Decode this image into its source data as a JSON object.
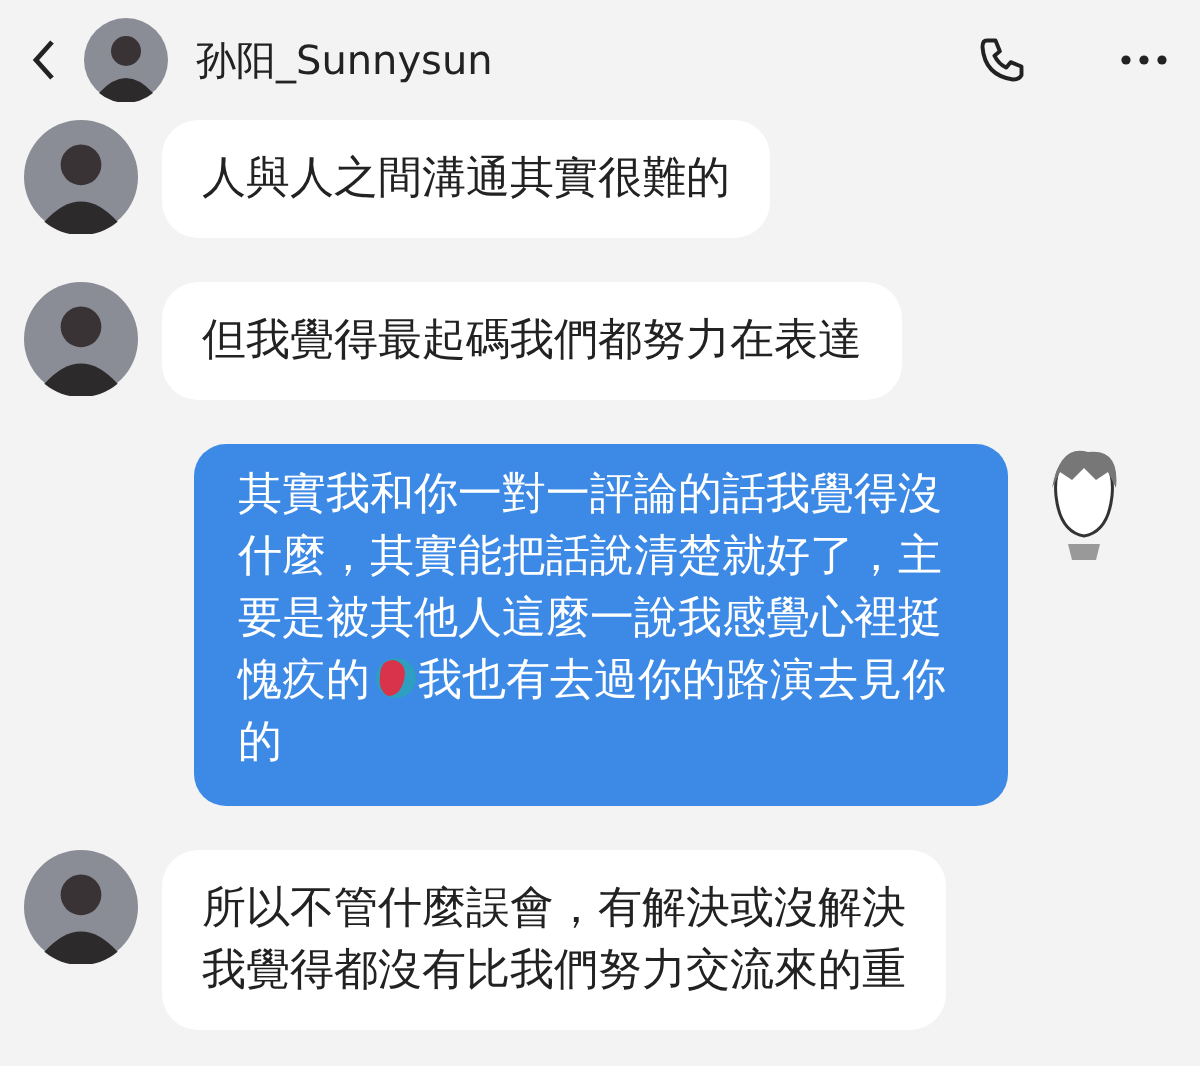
{
  "header": {
    "name": "孙阳_Sunnysun"
  },
  "messages": [
    {
      "kind": "received",
      "lines": [
        [
          {
            "kind": "text",
            "text": "人與人之間溝通其實很難的"
          }
        ]
      ]
    },
    {
      "kind": "received",
      "lines": [
        [
          {
            "kind": "text",
            "text": "但我覺得最起碼我們都努力在表達"
          }
        ]
      ]
    },
    {
      "kind": "sent",
      "lines": [
        [
          {
            "kind": "text",
            "text": "其實我和你一對一評論的話我覺得沒"
          }
        ],
        [
          {
            "kind": "text",
            "text": "什麼，其實能把話說清楚就好了，主"
          }
        ],
        [
          {
            "kind": "text",
            "text": "要是被其他人這麼一說我感覺心裡挺"
          }
        ],
        [
          {
            "kind": "text",
            "text": "愧疚的"
          },
          {
            "kind": "emoji"
          },
          {
            "kind": "text",
            "text": "我也有去過你的路演去見你"
          }
        ],
        [
          {
            "kind": "text",
            "text": "的"
          }
        ]
      ]
    },
    {
      "kind": "received",
      "lines": [
        [
          {
            "kind": "text",
            "text": "所以不管什麼誤會，有解決或沒解決"
          }
        ],
        [
          {
            "kind": "text",
            "text": "我覺得都沒有比我們努力交流來的重"
          }
        ]
      ]
    }
  ]
}
